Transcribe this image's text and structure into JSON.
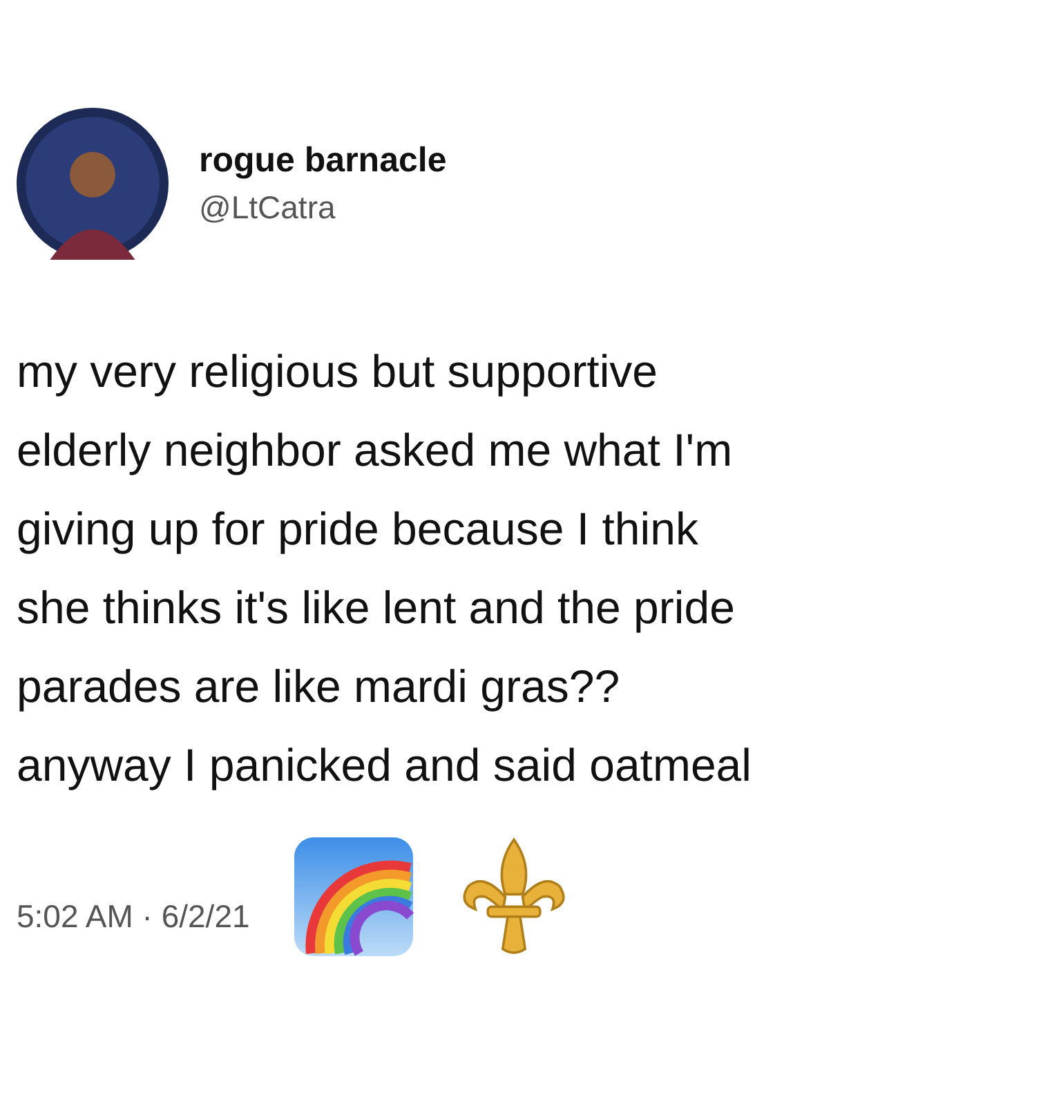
{
  "tweet": {
    "author": {
      "name": "rogue barnacle",
      "handle": "@LtCatra"
    },
    "text_lines": [
      "my very religious but supportive",
      "elderly neighbor asked me what I'm",
      "giving up for pride because I think",
      "she thinks it's like lent and the pride",
      "parades are like mardi gras??",
      "anyway I panicked and said oatmeal"
    ],
    "timestamp": "5:02 AM · 6/2/21"
  }
}
